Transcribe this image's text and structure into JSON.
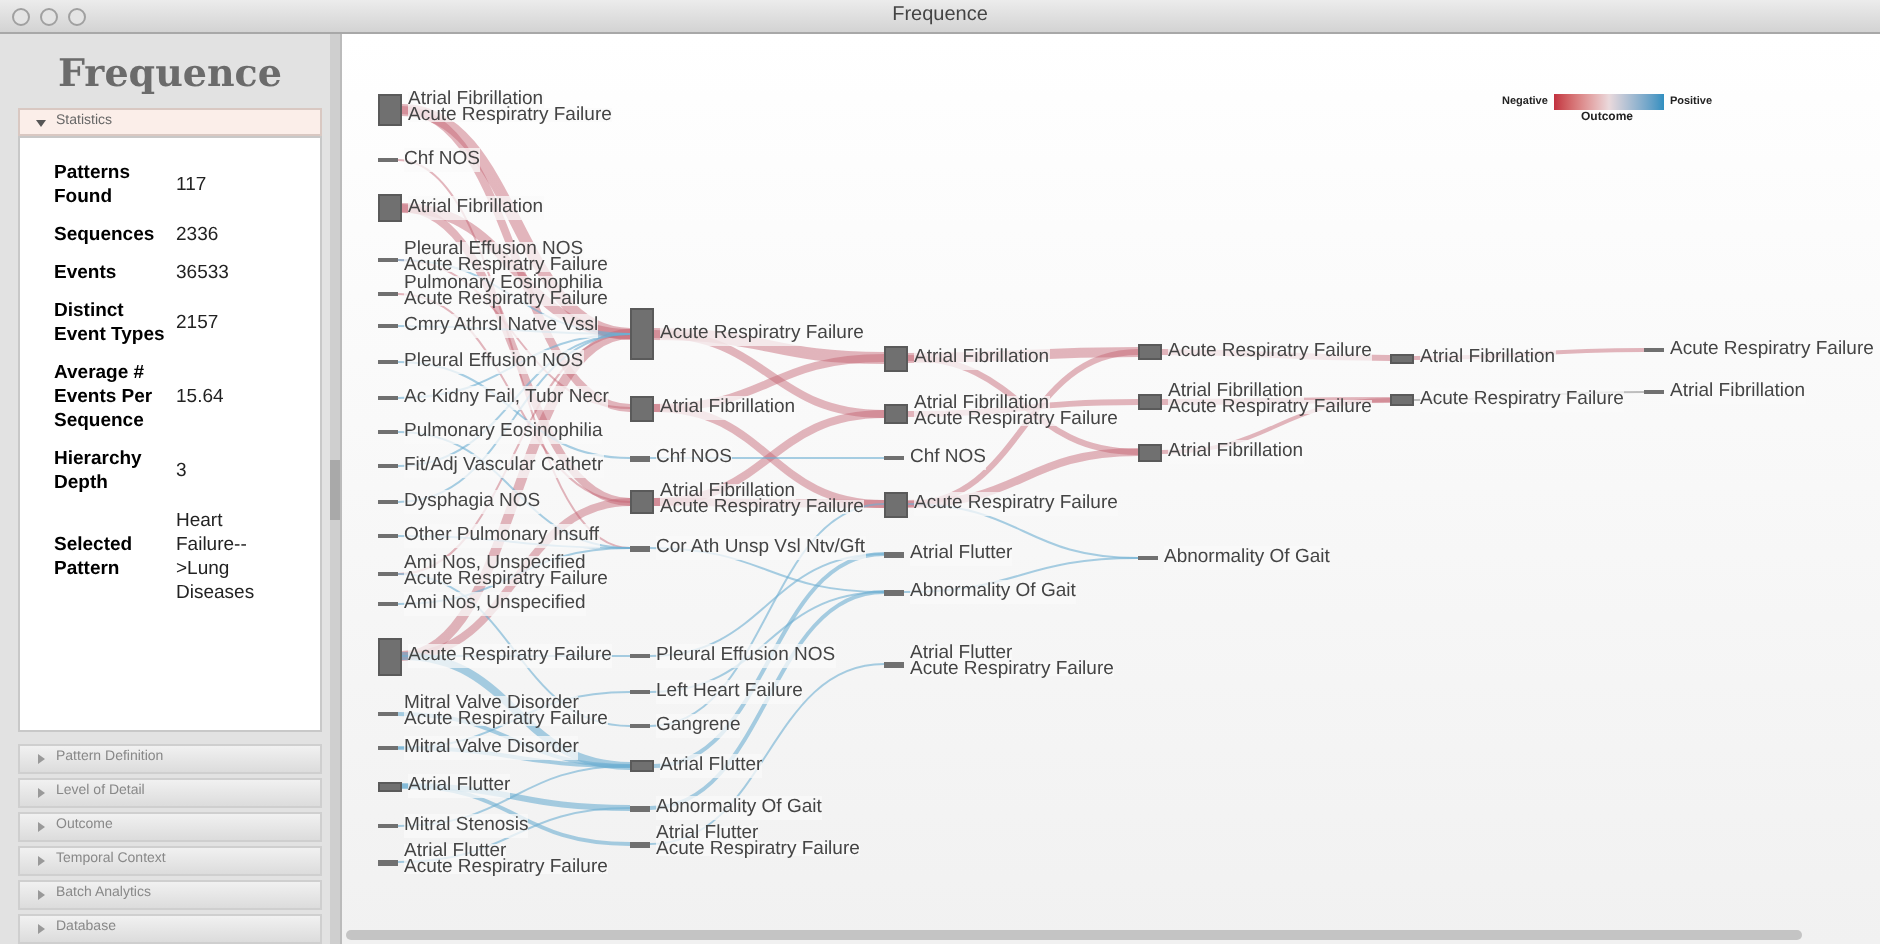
{
  "window": {
    "title": "Frequence"
  },
  "sidebar": {
    "logo": "Frequence",
    "statistics": [
      {
        "label": "Patterns Found",
        "value": "117"
      },
      {
        "label": "Sequences",
        "value": "2336"
      },
      {
        "label": "Events",
        "value": "36533"
      },
      {
        "label": "Distinct Event Types",
        "value": "2157"
      },
      {
        "label": "Average # Events Per Sequence",
        "value": "15.64"
      },
      {
        "label": "Hierarchy Depth",
        "value": "3"
      },
      {
        "label": "Selected Pattern",
        "value": "Heart Failure-->Lung Diseases"
      }
    ],
    "sections": [
      {
        "title": "Statistics",
        "expanded": true
      },
      {
        "title": "Pattern Definition",
        "expanded": false
      },
      {
        "title": "Level of Detail",
        "expanded": false
      },
      {
        "title": "Outcome",
        "expanded": false
      },
      {
        "title": "Temporal Context",
        "expanded": false
      },
      {
        "title": "Batch Analytics",
        "expanded": false
      },
      {
        "title": "Database",
        "expanded": false
      }
    ]
  },
  "legend": {
    "negative_label": "Negative",
    "positive_label": "Positive",
    "title": "Outcome"
  },
  "columns": [
    {
      "nodes": [
        {
          "labels": [
            "Atrial Fibrillation",
            "Acute Respiratry Failure"
          ]
        },
        {
          "labels": [
            "Chf NOS"
          ]
        },
        {
          "labels": [
            "Atrial Fibrillation"
          ]
        },
        {
          "labels": [
            "Pleural Effusion NOS",
            "Acute Respiratry Failure"
          ]
        },
        {
          "labels": [
            "Pulmonary Eosinophilia",
            "Acute Respiratry Failure"
          ]
        },
        {
          "labels": [
            "Cmry Athrsl Natve Vssl"
          ]
        },
        {
          "labels": [
            "Pleural Effusion NOS"
          ]
        },
        {
          "labels": [
            "Ac Kidny Fail, Tubr Necr"
          ]
        },
        {
          "labels": [
            "Pulmonary Eosinophilia"
          ]
        },
        {
          "labels": [
            "Fit/Adj Vascular Cathetr"
          ]
        },
        {
          "labels": [
            "Dysphagia NOS"
          ]
        },
        {
          "labels": [
            "Other Pulmonary Insuff"
          ]
        },
        {
          "labels": [
            "Ami Nos, Unspecified",
            "Acute Respiratry Failure"
          ]
        },
        {
          "labels": [
            "Ami Nos, Unspecified"
          ]
        },
        {
          "labels": [
            "Acute Respiratry Failure"
          ]
        },
        {
          "labels": [
            "Mitral Valve Disorder",
            "Acute Respiratry Failure"
          ]
        },
        {
          "labels": [
            "Mitral Valve Disorder"
          ]
        },
        {
          "labels": [
            "Atrial Flutter"
          ]
        },
        {
          "labels": [
            "Mitral Stenosis"
          ]
        },
        {
          "labels": [
            "Atrial Flutter",
            "Acute Respiratry Failure"
          ]
        }
      ]
    },
    {
      "nodes": [
        {
          "labels": [
            "Acute Respiratry Failure"
          ]
        },
        {
          "labels": [
            "Atrial Fibrillation"
          ]
        },
        {
          "labels": [
            "Chf NOS"
          ]
        },
        {
          "labels": [
            "Atrial Fibrillation",
            "Acute Respiratry Failure"
          ]
        },
        {
          "labels": [
            "Cor Ath Unsp Vsl Ntv/Gft"
          ]
        },
        {
          "labels": [
            "Pleural Effusion NOS"
          ]
        },
        {
          "labels": [
            "Left Heart Failure"
          ]
        },
        {
          "labels": [
            "Gangrene"
          ]
        },
        {
          "labels": [
            "Atrial Flutter"
          ]
        },
        {
          "labels": [
            "Abnormality Of Gait"
          ]
        },
        {
          "labels": [
            "Atrial Flutter",
            "Acute Respiratry Failure"
          ]
        }
      ]
    },
    {
      "nodes": [
        {
          "labels": [
            "Atrial Fibrillation"
          ]
        },
        {
          "labels": [
            "Atrial Fibrillation",
            "Acute Respiratry Failure"
          ]
        },
        {
          "labels": [
            "Chf NOS"
          ]
        },
        {
          "labels": [
            "Acute Respiratry Failure"
          ]
        },
        {
          "labels": [
            "Atrial Flutter"
          ]
        },
        {
          "labels": [
            "Abnormality Of Gait"
          ]
        },
        {
          "labels": [
            "Atrial Flutter",
            "Acute Respiratry Failure"
          ]
        }
      ]
    },
    {
      "nodes": [
        {
          "labels": [
            "Acute Respiratry Failure"
          ]
        },
        {
          "labels": [
            "Atrial Fibrillation",
            "Acute Respiratry Failure"
          ]
        },
        {
          "labels": [
            "Atrial Fibrillation"
          ]
        },
        {
          "labels": [
            "Abnormality Of Gait"
          ]
        }
      ]
    },
    {
      "nodes": [
        {
          "labels": [
            "Atrial Fibrillation"
          ]
        },
        {
          "labels": [
            "Acute Respiratry Failure"
          ]
        }
      ]
    },
    {
      "nodes": [
        {
          "labels": [
            "Acute Respiratry Failure"
          ]
        },
        {
          "labels": [
            "Atrial Fibrillation"
          ]
        }
      ]
    }
  ]
}
